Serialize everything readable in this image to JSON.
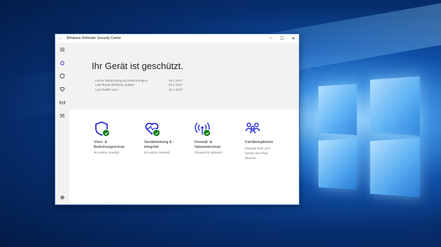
{
  "window": {
    "title": "Windows Defender Security Center",
    "back_label": "←",
    "minimize_label": "–",
    "maximize_label": "☐",
    "close_label": "✕"
  },
  "sidebar": {
    "items": [
      {
        "icon": "hamburger-icon"
      },
      {
        "icon": "home-icon"
      },
      {
        "icon": "shield-icon"
      },
      {
        "icon": "heart-icon"
      },
      {
        "icon": "wifi-icon"
      },
      {
        "icon": "family-icon"
      }
    ],
    "settings_icon": "gear-icon"
  },
  "hero": {
    "heading": "Ihr Gerät ist geschützt.",
    "info": [
      {
        "label": "Letzte Überprüfung auf Bedrohungen:",
        "value": "19.1.2017"
      },
      {
        "label": "Last threat definition update:",
        "value": "23.1.2017"
      },
      {
        "label": "Last health scan:",
        "value": "20.1.2017"
      }
    ]
  },
  "tiles": [
    {
      "name_line1": "Viren- &",
      "name_line2": "Bedrohungsschutz",
      "status": "No action needed."
    },
    {
      "name_line1": "Geräteleistung & -",
      "name_line2": "integrität",
      "status": "No action needed."
    },
    {
      "name_line1": "Firewall- &",
      "name_line2": "Netzwerkschutz",
      "status": "Firewall ist aktiviert."
    },
    {
      "name_line1": "Familienoptionen",
      "name_line2": "",
      "status": "Manage how your family uses their devices."
    }
  ],
  "colors": {
    "accent": "#2b30d9",
    "ok": "#107c10"
  }
}
